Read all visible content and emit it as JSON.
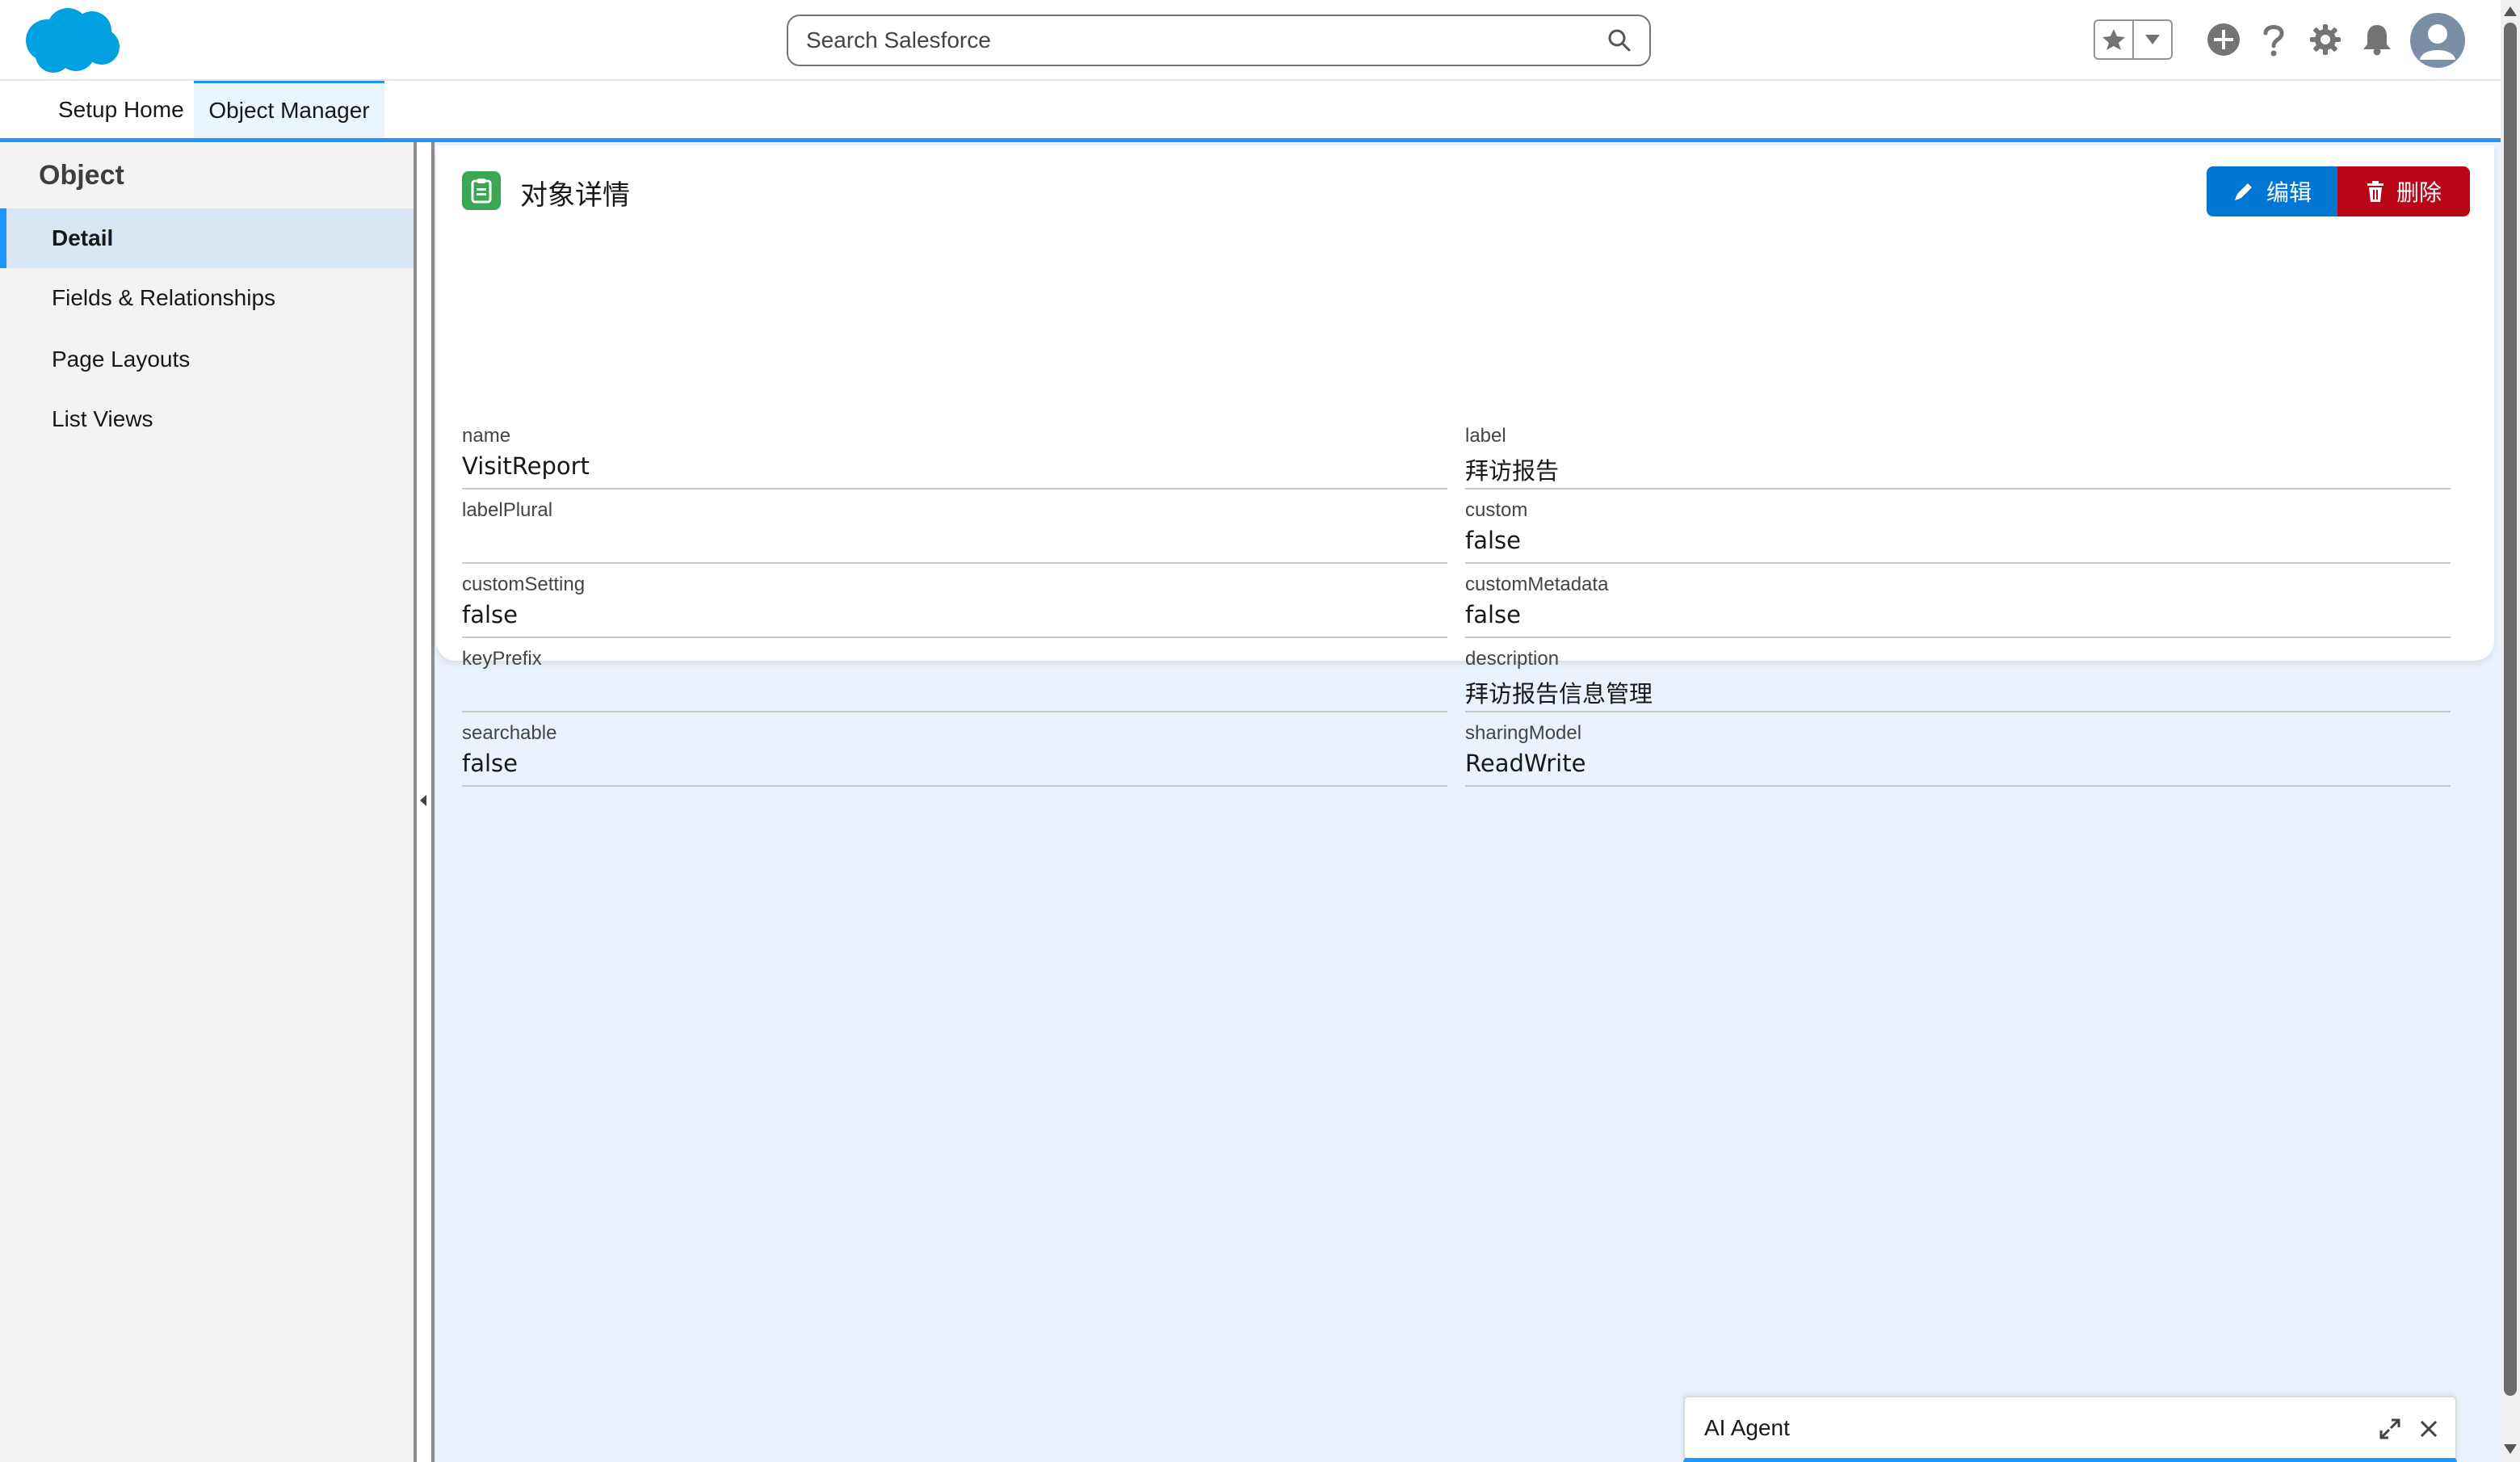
{
  "header": {
    "search_placeholder": "Search Salesforce",
    "icons": [
      "salesforce-cloud-logo",
      "search-icon",
      "favorites-star-icon",
      "favorites-dropdown-icon",
      "global-actions-plus-icon",
      "help-icon",
      "setup-gear-icon",
      "notifications-bell-icon",
      "avatar-icon"
    ],
    "brand_color": "#1b96ff"
  },
  "context_tabs": [
    {
      "label": "Setup Home"
    },
    {
      "label": "Object Manager"
    }
  ],
  "sidebar": {
    "title": "Object",
    "items": [
      {
        "label": "Detail",
        "active": true
      },
      {
        "label": "Fields & Relationships"
      },
      {
        "label": "Page Layouts"
      },
      {
        "label": "List Views"
      }
    ]
  },
  "detail": {
    "title": "对象详情",
    "edit_label": "编辑",
    "delete_label": "删除",
    "fields": [
      {
        "label": "name",
        "value": "VisitReport"
      },
      {
        "label": "label",
        "value": "拜访报告"
      },
      {
        "label": "labelPlural",
        "value": ""
      },
      {
        "label": "custom",
        "value": "false"
      },
      {
        "label": "customSetting",
        "value": "false"
      },
      {
        "label": "customMetadata",
        "value": "false"
      },
      {
        "label": "keyPrefix",
        "value": ""
      },
      {
        "label": "description",
        "value": "拜访报告信息管理"
      },
      {
        "label": "searchable",
        "value": "false"
      },
      {
        "label": "sharingModel",
        "value": "ReadWrite"
      }
    ]
  },
  "ai_agent": {
    "title": "AI Agent"
  },
  "colors": {
    "edit_button": "#0176d3",
    "delete_button": "#ba0517",
    "object_icon": "#3ba755",
    "page_background": "#eaf2fd"
  }
}
